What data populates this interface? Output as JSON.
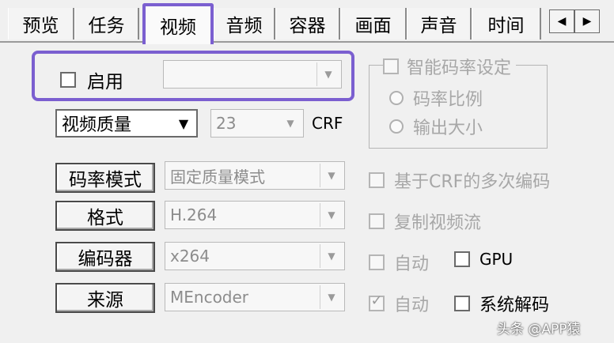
{
  "tabs": [
    {
      "label": "预览"
    },
    {
      "label": "任务"
    },
    {
      "label": "视频",
      "active": true
    },
    {
      "label": "音频"
    },
    {
      "label": "容器"
    },
    {
      "label": "画面"
    },
    {
      "label": "声音"
    },
    {
      "label": "时间"
    }
  ],
  "tab_nav": {
    "prev": "◀",
    "next": "▶"
  },
  "enable": {
    "label": "启用",
    "checked": false,
    "combo_value": ""
  },
  "smart_bitrate": {
    "group_label": "智能码率设定",
    "checked": false,
    "radio_ratio": "码率比例",
    "radio_size": "输出大小"
  },
  "quality": {
    "mode_value": "视频质量",
    "value": "23",
    "unit": "CRF"
  },
  "rows": {
    "bitrate_mode": {
      "button": "码率模式",
      "value": "固定质量模式"
    },
    "format": {
      "button": "格式",
      "value": "H.264"
    },
    "encoder": {
      "button": "编码器",
      "value": "x264"
    },
    "source": {
      "button": "来源",
      "value": "MEncoder"
    }
  },
  "options": {
    "crf_multipass": "基于CRF的多次编码",
    "copy_stream": "复制视频流",
    "auto_encoder": "自动",
    "gpu": "GPU",
    "auto_source": "自动",
    "system_decode": "系统解码"
  },
  "watermark": "头条 @APP猿",
  "colors": {
    "highlight": "#7b5fd0"
  }
}
